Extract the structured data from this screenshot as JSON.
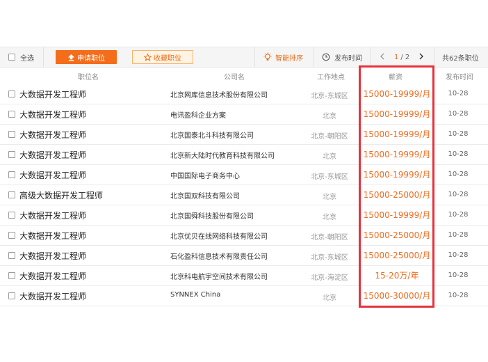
{
  "toolbar": {
    "select_all": "全选",
    "apply_label": "申请职位",
    "fav_label": "收藏职位",
    "smart_sort": "智能排序",
    "publish_time": "发布时间",
    "page_current": "1",
    "page_total": "/ 2",
    "total_count": "共62条职位"
  },
  "columns": {
    "position": "职位名",
    "company": "公司名",
    "location": "工作地点",
    "salary": "薪资",
    "date": "发布时间"
  },
  "jobs": [
    {
      "title": "大数据开发工程师",
      "company": "北京网库信息技术股份有限公司",
      "location": "北京-东城区",
      "salary": "15000-19999/月",
      "date": "10-28"
    },
    {
      "title": "大数据开发工程师",
      "company": "电讯盈科企业方案",
      "location": "北京",
      "salary": "15000-19999/月",
      "date": "10-28"
    },
    {
      "title": "大数据开发工程师",
      "company": "北京国泰北斗科技有限公司",
      "location": "北京-朝阳区",
      "salary": "15000-19999/月",
      "date": "10-28"
    },
    {
      "title": "大数据开发工程师",
      "company": "北京新大陆时代教育科技有限公司",
      "location": "北京",
      "salary": "15000-19999/月",
      "date": "10-28"
    },
    {
      "title": "大数据开发工程师",
      "company": "中国国际电子商务中心",
      "location": "北京-东城区",
      "salary": "15000-19999/月",
      "date": "10-28"
    },
    {
      "title": "高级大数据开发工程师",
      "company": "北京国双科技有限公司",
      "location": "北京",
      "salary": "15000-25000/月",
      "date": "10-28"
    },
    {
      "title": "大数据开发工程师",
      "company": "北京国舜科技股份有限公司",
      "location": "北京",
      "salary": "15000-19999/月",
      "date": "10-28"
    },
    {
      "title": "大数据开发工程师",
      "company": "北京优贝在线网络科技有限公司",
      "location": "北京-朝阳区",
      "salary": "15000-25000/月",
      "date": "10-28"
    },
    {
      "title": "大数据开发工程师",
      "company": "石化盈科信息技术有限责任公司",
      "location": "北京-东城区",
      "salary": "15000-25000/月",
      "date": "10-28"
    },
    {
      "title": "大数据开发工程师",
      "company": "北京科电航宇空间技术有限公司",
      "location": "北京-海淀区",
      "salary": "15-20万/年",
      "date": "10-28"
    },
    {
      "title": "大数据开发工程师",
      "company": "SYNNEX China",
      "location": "北京",
      "salary": "15000-30000/月",
      "date": "10-28"
    }
  ],
  "colors": {
    "accent": "#f46d1b",
    "salary": "#f26b1d",
    "highlight_border": "#e5323b"
  },
  "icons": [
    "checkbox-icon",
    "upload-icon",
    "star-icon",
    "bulb-icon",
    "clock-icon",
    "chevron-left-icon",
    "chevron-right-icon"
  ]
}
